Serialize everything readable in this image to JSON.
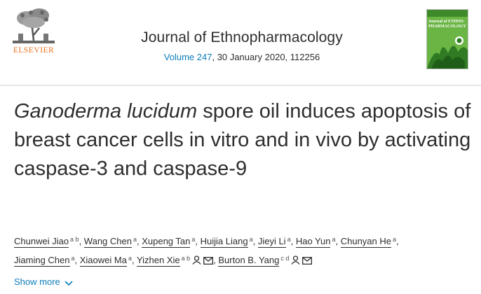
{
  "header": {
    "publisher": "ELSEVIER",
    "journal_title": "Journal of Ethnopharmacology",
    "volume_link": "Volume 247",
    "issue_details": ", 30 January 2020, 112256",
    "cover_text": "Journal of ETHNO- PHARMACOLOGY"
  },
  "article": {
    "title_italic": "Ganoderma lucidum",
    "title_rest": " spore oil induces apoptosis of breast cancer cells in vitro and in vivo by activating caspase-3 and caspase-9"
  },
  "authors": [
    {
      "name": "Chunwei Jiao",
      "sup": "a b"
    },
    {
      "name": "Wang Chen",
      "sup": "a"
    },
    {
      "name": "Xupeng Tan",
      "sup": "a"
    },
    {
      "name": "Huijia Liang",
      "sup": "a"
    },
    {
      "name": "Jieyi Li",
      "sup": "a"
    },
    {
      "name": "Hao Yun",
      "sup": "a"
    },
    {
      "name": "Chunyan He",
      "sup": "a"
    },
    {
      "name": "Jiaming Chen",
      "sup": "a"
    },
    {
      "name": "Xiaowei Ma",
      "sup": "a"
    },
    {
      "name": "Yizhen Xie",
      "sup": "a b"
    },
    {
      "name": "Burton B. Yang",
      "sup": "c d"
    }
  ],
  "show_more": "Show more",
  "colors": {
    "accent": "#0c7dbb",
    "publisher": "#e9711c",
    "text": "#2e2e2e"
  },
  "icons": [
    "person-icon",
    "envelope-icon",
    "chevron-down-icon"
  ]
}
